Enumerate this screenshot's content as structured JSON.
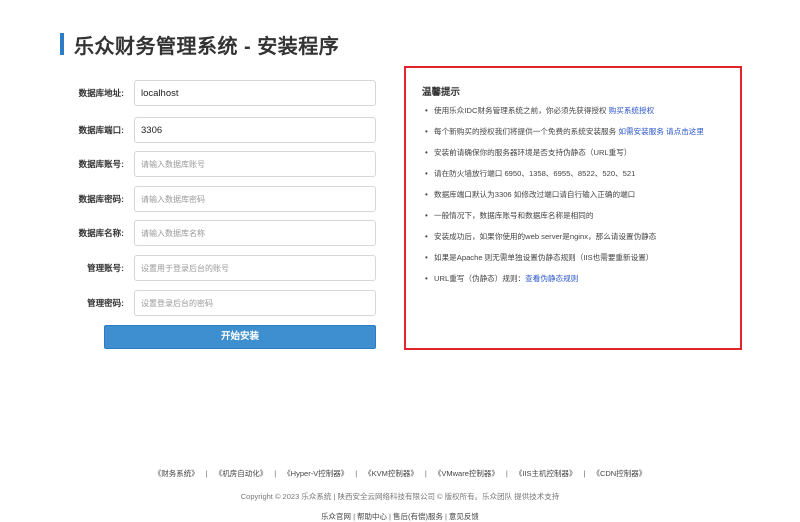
{
  "header": {
    "title": "乐众财务管理系统 - 安装程序"
  },
  "form": {
    "fields": [
      {
        "label": "数据库地址:",
        "value": "localhost",
        "placeholder": ""
      },
      {
        "label": "数据库端口:",
        "value": "3306",
        "placeholder": ""
      },
      {
        "label": "数据库账号:",
        "value": "",
        "placeholder": "请输入数据库账号"
      },
      {
        "label": "数据库密码:",
        "value": "",
        "placeholder": "请输入数据库密码"
      },
      {
        "label": "数据库名称:",
        "value": "",
        "placeholder": "请输入数据库名称"
      },
      {
        "label": "管理账号:",
        "value": "",
        "placeholder": "设置用于登录后台的账号"
      },
      {
        "label": "管理密码:",
        "value": "",
        "placeholder": "设置登录后台的密码"
      }
    ],
    "submit_label": "开始安装"
  },
  "tips": {
    "title": "温馨提示",
    "items": [
      {
        "text": "使用乐众IDC财务管理系统之前，你必须先获得授权 ",
        "link": "购买系统授权"
      },
      {
        "text": "每个新购买的授权我们将提供一个免费的系统安装服务 ",
        "link": "如需安装服务 请点击这里"
      },
      {
        "text": "安装前请确保你的服务器环境是否支持伪静态（URL重写）",
        "link": ""
      },
      {
        "text": "请在防火墙放行端口 6950、1358、6955、8522、520、521",
        "link": ""
      },
      {
        "text": "数据库端口默认为3306 如修改过端口请自行输入正确的端口",
        "link": ""
      },
      {
        "text": "一般情况下，数据库账号和数据库名称是相同的",
        "link": ""
      },
      {
        "text": "安装成功后，如果你使用的web server是nginx，那么请设置伪静态",
        "link": ""
      },
      {
        "text": "如果是Apache 则无需单独设置伪静态规则（IIS也需要重新设置）",
        "link": ""
      },
      {
        "text": "URL重写（伪静态）规则：",
        "link": "查看伪静态规则"
      }
    ]
  },
  "footer": {
    "links": [
      "《财务系统》",
      "《机房自动化》",
      "《Hyper-V控制器》",
      "《KVM控制器》",
      "《VMware控制器》",
      "《IIS主机控制器》",
      "《CDN控制器》"
    ],
    "separator": "|",
    "copyright": "Copyright © 2023 乐众系统 | 陕西安全云网络科技有限公司 © 版权所有。乐众团队 提供技术支持",
    "bottom_links": [
      "乐众官网",
      "帮助中心",
      "售后(有偿)服务",
      "意见反馈"
    ]
  },
  "colors": {
    "accent": "#2e7cc4",
    "button": "#3d8fcf",
    "tips_border": "#e0262b",
    "link": "#2a55c9"
  }
}
